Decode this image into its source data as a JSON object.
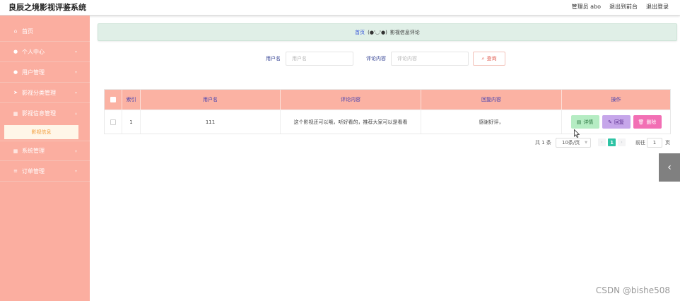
{
  "header": {
    "app_title": "良辰之境影视评鉴系统",
    "admin_label": "管理员 abo",
    "exit_front": "退出到前台",
    "logout": "退出登录"
  },
  "sidebar": {
    "items": [
      {
        "label": "首页",
        "icon": "home-icon"
      },
      {
        "label": "个人中心",
        "icon": "user-icon"
      },
      {
        "label": "用户管理",
        "icon": "user-icon"
      },
      {
        "label": "影视分类管理",
        "icon": "send-icon"
      },
      {
        "label": "影视信息管理",
        "icon": "grid-icon"
      },
      {
        "label": "系统管理",
        "icon": "grid-icon"
      },
      {
        "label": "订单管理",
        "icon": "list-icon"
      }
    ],
    "active_submenu": "影视信息"
  },
  "breadcrumb": {
    "home": "首页",
    "separator": "(●'◡'●)",
    "current": "影视信息评论"
  },
  "search": {
    "username_label": "用户名",
    "username_placeholder": "用户名",
    "comment_label": "评论内容",
    "comment_placeholder": "评论内容",
    "search_button": "查询"
  },
  "table": {
    "headers": [
      "索引",
      "用户名",
      "评论内容",
      "回复内容",
      "操作"
    ],
    "rows": [
      {
        "index": "1",
        "username": "111",
        "comment": "这个影视还可以哦，听好看的，推荐大家可以是看看",
        "reply": "感谢好评，",
        "actions": [
          "详情",
          "回复",
          "删除"
        ]
      }
    ]
  },
  "pagination": {
    "total": "共 1 条",
    "page_size": "10条/页",
    "current_page": "1",
    "goto_label": "前往",
    "goto_value": "1",
    "page_suffix": "页"
  },
  "watermark": "CSDN @bishe508",
  "colors": {
    "sidebar": "#fbaea0",
    "breadcrumb_bg": "#e0efe7",
    "table_header": "#fbb2a3",
    "btn_detail": "#b5ecc3",
    "btn_reply": "#c6a6ea",
    "btn_delete": "#f26fb4",
    "pager_active": "#2ec3a4"
  }
}
